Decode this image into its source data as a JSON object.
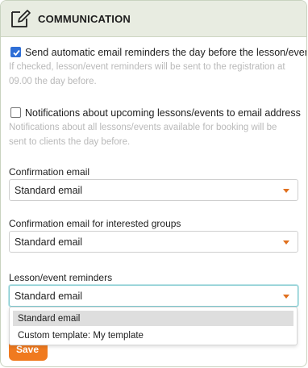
{
  "section": {
    "title": "COMMUNICATION",
    "icon": "edit-note-icon"
  },
  "options": [
    {
      "checked": true,
      "label": "Send automatic email reminders the day before the lesson/event",
      "help_line1": "If checked, lesson/event reminders will be sent to the registration at",
      "help_line2": "09.00 the day before."
    },
    {
      "checked": false,
      "label": "Notifications about upcoming lessons/events to email address",
      "help_line1": "Notifications about all lessons/events available for booking will be",
      "help_line2": "sent to clients the day before."
    }
  ],
  "fields": [
    {
      "label": "Confirmation email",
      "value": "Standard email"
    },
    {
      "label": "Confirmation email for interested groups",
      "value": "Standard email"
    },
    {
      "label": "Lesson/event reminders",
      "value": "Standard email"
    }
  ],
  "dropdown": {
    "options": [
      "Standard email",
      "Custom template: My template"
    ],
    "selected": "Standard email"
  },
  "save_label": "Save",
  "colors": {
    "accent": "#f07a1f",
    "checkbox": "#2f6fd6",
    "header_bg": "#e8ece1"
  }
}
